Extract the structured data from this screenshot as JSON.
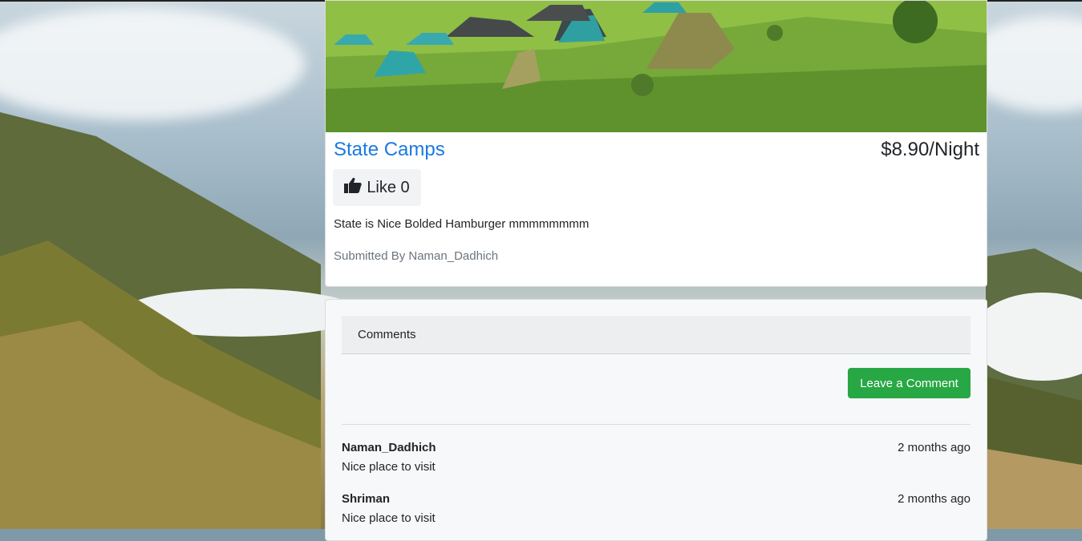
{
  "campground": {
    "name": "State Camps",
    "price": "$8.90/Night",
    "like_label": "Like 0",
    "description": "State is Nice Bolded Hamburger mmmmmmmm",
    "submitted_by": "Submitted By Naman_Dadhich"
  },
  "comments_section": {
    "header": "Comments",
    "leave_comment_label": "Leave a Comment",
    "items": [
      {
        "author": "Naman_Dadhich",
        "time": "2 months ago",
        "text": "Nice place to visit"
      },
      {
        "author": "Shriman",
        "time": "2 months ago",
        "text": "Nice place to visit"
      }
    ]
  },
  "icons": {
    "like": "thumbs-up-icon"
  },
  "colors": {
    "title_link": "#1a7ae0",
    "leave_button": "#28a745",
    "muted_text": "#6c757d"
  }
}
